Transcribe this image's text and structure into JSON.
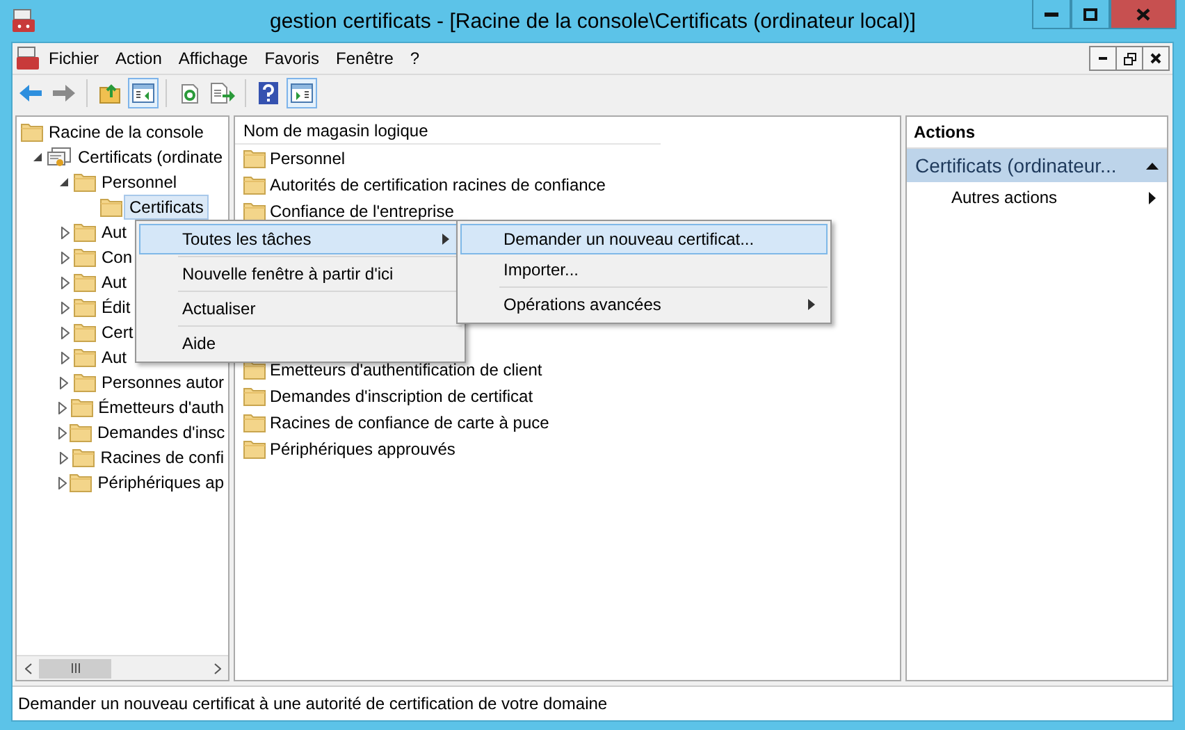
{
  "window": {
    "title": "gestion certificats - [Racine de la console\\Certificats (ordinateur local)]"
  },
  "menu_bar": [
    "Fichier",
    "Action",
    "Affichage",
    "Favoris",
    "Fenêtre",
    "?"
  ],
  "toolbar": [
    {
      "kind": "back",
      "pressed": false
    },
    {
      "kind": "forward",
      "pressed": false
    },
    {
      "kind": "sep"
    },
    {
      "kind": "up",
      "pressed": false
    },
    {
      "kind": "tree",
      "pressed": true
    },
    {
      "kind": "sep"
    },
    {
      "kind": "refresh",
      "pressed": false
    },
    {
      "kind": "export",
      "pressed": false
    },
    {
      "kind": "sep"
    },
    {
      "kind": "help",
      "pressed": false
    },
    {
      "kind": "actionpane",
      "pressed": true
    }
  ],
  "tree": {
    "label": "Racine de la console",
    "kind": "folder",
    "selected": false,
    "children": [
      {
        "label": "Certificats (ordinate",
        "kind": "certificate",
        "expanded": true,
        "selected": false,
        "children": [
          {
            "label": "Personnel",
            "kind": "folder",
            "expanded": true,
            "selected": false,
            "children": [
              {
                "label": "Certificats",
                "kind": "folder",
                "selected": true
              }
            ]
          },
          {
            "label": "Aut",
            "kind": "folder",
            "expanded": false,
            "selected": false
          },
          {
            "label": "Con",
            "kind": "folder",
            "expanded": false,
            "selected": false
          },
          {
            "label": "Aut",
            "kind": "folder",
            "expanded": false,
            "selected": false
          },
          {
            "label": "Édit",
            "kind": "folder",
            "expanded": false,
            "selected": false
          },
          {
            "label": "Cert",
            "kind": "folder",
            "expanded": false,
            "selected": false
          },
          {
            "label": "Aut",
            "kind": "folder",
            "expanded": false,
            "selected": false
          },
          {
            "label": "Personnes autor",
            "kind": "folder",
            "expanded": false,
            "selected": false
          },
          {
            "label": "Émetteurs d'auth",
            "kind": "folder",
            "expanded": false,
            "selected": false
          },
          {
            "label": "Demandes d'insc",
            "kind": "folder",
            "expanded": false,
            "selected": false
          },
          {
            "label": "Racines de confi",
            "kind": "folder",
            "expanded": false,
            "selected": false
          },
          {
            "label": "Périphériques ap",
            "kind": "folder",
            "expanded": false,
            "selected": false
          }
        ]
      }
    ]
  },
  "list": {
    "column": "Nom de magasin logique",
    "items_top": [
      "Personnel",
      "Autorités de certification racines de confiance",
      "Confiance de l'entreprise"
    ],
    "items_bottom": [
      "Émetteurs d'authentification de client",
      "Demandes d'inscription de certificat",
      "Racines de confiance de carte à puce",
      "Périphériques approuvés"
    ]
  },
  "actions": {
    "header": "Actions",
    "section": "Certificats (ordinateur...",
    "items": [
      "Autres actions"
    ]
  },
  "context_menu": [
    {
      "label": "Toutes les tâches",
      "selected": true,
      "submenu": true
    },
    {
      "label": "Nouvelle fenêtre à partir d'ici",
      "selected": false,
      "submenu": false
    },
    {
      "label": "Actualiser",
      "selected": false,
      "submenu": false
    },
    {
      "label": "Aide",
      "selected": false,
      "submenu": false
    }
  ],
  "submenu": [
    {
      "label": "Demander un nouveau certificat...",
      "selected": true,
      "submenu": false
    },
    {
      "label": "Importer...",
      "selected": false,
      "submenu": false
    },
    {
      "label": "Opérations avancées",
      "selected": false,
      "submenu": true
    }
  ],
  "status_bar": "Demander un nouveau certificat à une autorité de certification de votre domaine"
}
